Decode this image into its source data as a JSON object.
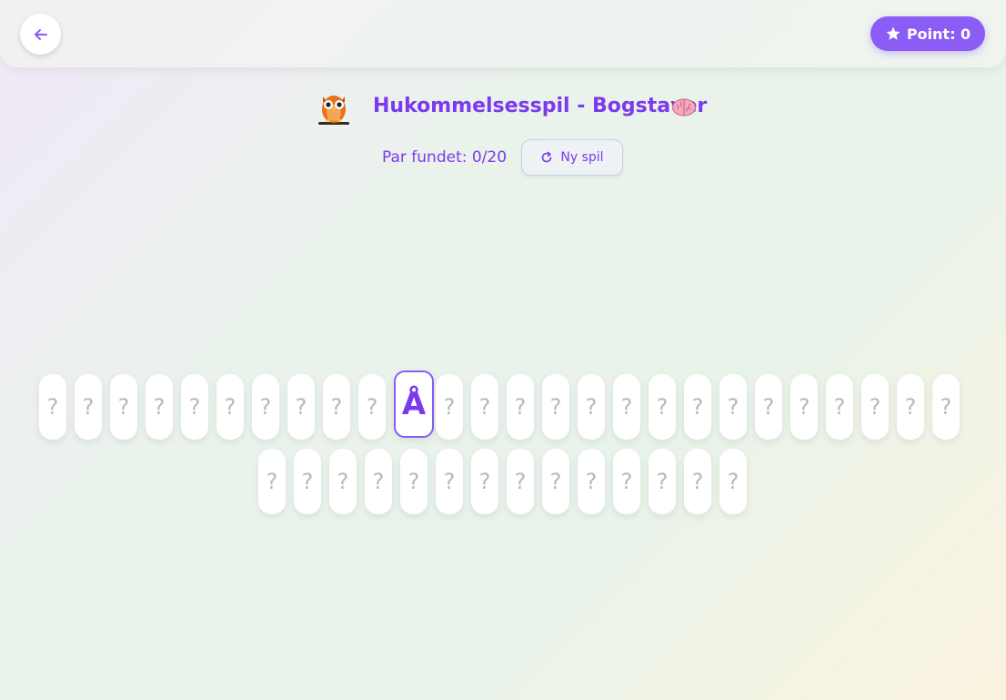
{
  "header": {
    "points_label": "Point: 0"
  },
  "title": {
    "text": "Hukommelsesspil - Bogstaver",
    "left_icon": "owl-icon",
    "right_icon": "brain-icon"
  },
  "status": {
    "pairs_found": "Par fundet: 0/20",
    "new_game_label": "Ny spil"
  },
  "colors": {
    "accent": "#8b5cf6",
    "title": "#7c3aed",
    "card_back": "#ffffff",
    "card_mark": "#b8b8b8"
  },
  "board": {
    "total_cards": 40,
    "rows": [
      26,
      14
    ],
    "cards": [
      {
        "face": "?",
        "flipped": false
      },
      {
        "face": "?",
        "flipped": false
      },
      {
        "face": "?",
        "flipped": false
      },
      {
        "face": "?",
        "flipped": false
      },
      {
        "face": "?",
        "flipped": false
      },
      {
        "face": "?",
        "flipped": false
      },
      {
        "face": "?",
        "flipped": false
      },
      {
        "face": "?",
        "flipped": false
      },
      {
        "face": "?",
        "flipped": false
      },
      {
        "face": "?",
        "flipped": false
      },
      {
        "face": "Å",
        "flipped": true
      },
      {
        "face": "?",
        "flipped": false
      },
      {
        "face": "?",
        "flipped": false
      },
      {
        "face": "?",
        "flipped": false
      },
      {
        "face": "?",
        "flipped": false
      },
      {
        "face": "?",
        "flipped": false
      },
      {
        "face": "?",
        "flipped": false
      },
      {
        "face": "?",
        "flipped": false
      },
      {
        "face": "?",
        "flipped": false
      },
      {
        "face": "?",
        "flipped": false
      },
      {
        "face": "?",
        "flipped": false
      },
      {
        "face": "?",
        "flipped": false
      },
      {
        "face": "?",
        "flipped": false
      },
      {
        "face": "?",
        "flipped": false
      },
      {
        "face": "?",
        "flipped": false
      },
      {
        "face": "?",
        "flipped": false
      },
      {
        "face": "?",
        "flipped": false
      },
      {
        "face": "?",
        "flipped": false
      },
      {
        "face": "?",
        "flipped": false
      },
      {
        "face": "?",
        "flipped": false
      },
      {
        "face": "?",
        "flipped": false
      },
      {
        "face": "?",
        "flipped": false
      },
      {
        "face": "?",
        "flipped": false
      },
      {
        "face": "?",
        "flipped": false
      },
      {
        "face": "?",
        "flipped": false
      },
      {
        "face": "?",
        "flipped": false
      },
      {
        "face": "?",
        "flipped": false
      },
      {
        "face": "?",
        "flipped": false
      },
      {
        "face": "?",
        "flipped": false
      },
      {
        "face": "?",
        "flipped": false
      }
    ]
  }
}
